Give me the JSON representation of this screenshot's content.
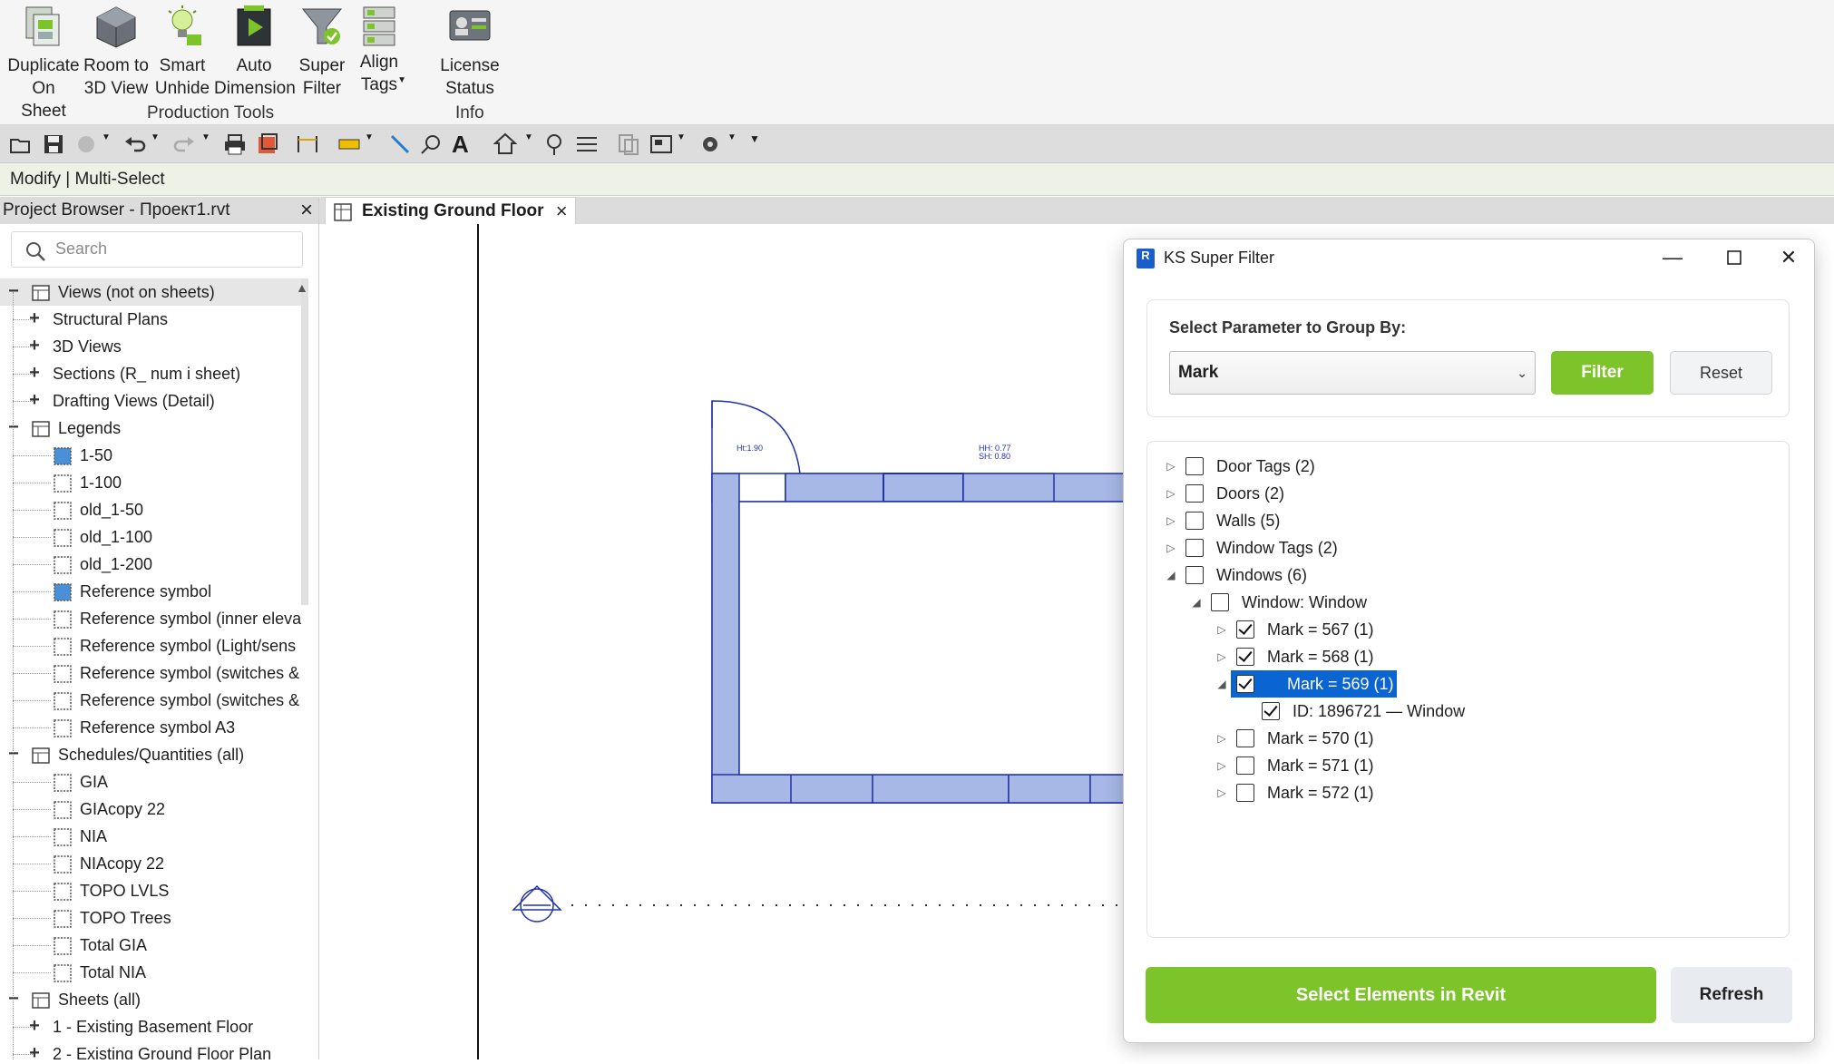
{
  "ribbon": {
    "tools": [
      {
        "label_1": "Duplicate",
        "label_2": "On Sheet",
        "icon": "duplicate-sheet-icon"
      },
      {
        "label_1": "Room to",
        "label_2": "3D View",
        "icon": "room-3d-icon"
      },
      {
        "label_1": "Smart",
        "label_2": "Unhide",
        "icon": "smart-unhide-icon"
      },
      {
        "label_1": "Auto",
        "label_2": "Dimension",
        "icon": "auto-dimension-icon"
      },
      {
        "label_1": "Super",
        "label_2": "Filter",
        "icon": "super-filter-icon"
      },
      {
        "label_1": "Align",
        "label_2": "Tags",
        "icon": "align-tags-icon"
      },
      {
        "label_1": "License Status",
        "label_2": "",
        "icon": "license-status-icon"
      }
    ],
    "panels": {
      "production": "Production Tools",
      "info": "Info"
    }
  },
  "modify_bar": {
    "text": "Modify | Multi-Select"
  },
  "project_browser": {
    "title": "Project Browser - Проект1.rvt",
    "search_placeholder": "Search",
    "items": [
      {
        "label": "Views (not on sheets)",
        "level": 0,
        "toggle": "−",
        "icon": "views-icon"
      },
      {
        "label": "Structural Plans",
        "level": 1,
        "toggle": "+"
      },
      {
        "label": "3D Views",
        "level": 1,
        "toggle": "+"
      },
      {
        "label": "Sections (R_ num i sheet)",
        "level": 1,
        "toggle": "+"
      },
      {
        "label": "Drafting Views (Detail)",
        "level": 1,
        "toggle": "+"
      },
      {
        "label": "Legends",
        "level": 0,
        "toggle": "−",
        "icon": "legend-icon"
      },
      {
        "label": "1-50",
        "level": 2,
        "icon": "legend-view-filled-icon"
      },
      {
        "label": "1-100",
        "level": 2,
        "icon": "legend-view-icon"
      },
      {
        "label": "old_1-50",
        "level": 2,
        "icon": "legend-view-icon"
      },
      {
        "label": "old_1-100",
        "level": 2,
        "icon": "legend-view-icon"
      },
      {
        "label": "old_1-200",
        "level": 2,
        "icon": "legend-view-icon"
      },
      {
        "label": "Reference symbol",
        "level": 2,
        "icon": "legend-view-filled-icon"
      },
      {
        "label": "Reference symbol (inner eleva",
        "level": 2,
        "icon": "legend-view-icon"
      },
      {
        "label": "Reference symbol (Light/sens",
        "level": 2,
        "icon": "legend-view-icon"
      },
      {
        "label": "Reference symbol (switches &",
        "level": 2,
        "icon": "legend-view-icon"
      },
      {
        "label": "Reference symbol (switches &",
        "level": 2,
        "icon": "legend-view-icon"
      },
      {
        "label": "Reference symbol A3",
        "level": 2,
        "icon": "legend-view-icon"
      },
      {
        "label": "Schedules/Quantities (all)",
        "level": 0,
        "toggle": "−",
        "icon": "schedule-icon"
      },
      {
        "label": "GIA",
        "level": 2,
        "icon": "schedule-view-icon"
      },
      {
        "label": "GIAcopy 22",
        "level": 2,
        "icon": "schedule-view-icon"
      },
      {
        "label": "NIA",
        "level": 2,
        "icon": "schedule-view-icon"
      },
      {
        "label": "NIAcopy 22",
        "level": 2,
        "icon": "schedule-view-icon"
      },
      {
        "label": "TOPO LVLS",
        "level": 2,
        "icon": "schedule-view-icon"
      },
      {
        "label": "TOPO Trees",
        "level": 2,
        "icon": "schedule-view-icon"
      },
      {
        "label": "Total GIA",
        "level": 2,
        "icon": "schedule-view-icon"
      },
      {
        "label": "Total NIA",
        "level": 2,
        "icon": "schedule-view-icon"
      },
      {
        "label": "Sheets (all)",
        "level": 0,
        "toggle": "−",
        "icon": "sheets-icon"
      },
      {
        "label": "1 - Existing Basement Floor",
        "level": 1,
        "toggle": "+"
      },
      {
        "label": "2 - Existing Ground Floor Plan",
        "level": 1,
        "toggle": "+"
      }
    ]
  },
  "view_tab": {
    "label": "Existing Ground Floor"
  },
  "plan": {
    "door_tag": "Ht:1.90",
    "window_tag_1": "HH: 0.77",
    "window_tag_2": "SH: 0.80"
  },
  "dialog": {
    "title": "KS Super Filter",
    "app_badge": "R",
    "group_by_label": "Select Parameter to Group By:",
    "group_by_value": "Mark",
    "filter_label": "Filter",
    "reset_label": "Reset",
    "tree": [
      {
        "label": "Door Tags (2)",
        "indent": 0,
        "arrow": "▷",
        "checked": false
      },
      {
        "label": "Doors (2)",
        "indent": 0,
        "arrow": "▷",
        "checked": false
      },
      {
        "label": "Walls (5)",
        "indent": 0,
        "arrow": "▷",
        "checked": false
      },
      {
        "label": "Window Tags (2)",
        "indent": 0,
        "arrow": "▷",
        "checked": false
      },
      {
        "label": "Windows (6)",
        "indent": 0,
        "arrow": "◢",
        "checked": false
      },
      {
        "label": "Window: Window",
        "indent": 1,
        "arrow": "◢",
        "checked": false
      },
      {
        "label": "Mark = 567 (1)",
        "indent": 2,
        "arrow": "▷",
        "checked": true
      },
      {
        "label": "Mark = 568 (1)",
        "indent": 2,
        "arrow": "▷",
        "checked": true
      },
      {
        "label": "Mark = 569 (1)",
        "indent": 2,
        "arrow": "◢",
        "checked": true,
        "highlighted": true
      },
      {
        "label": "ID: 1896721 — Window",
        "indent": 3,
        "arrow": "",
        "checked": true
      },
      {
        "label": "Mark = 570 (1)",
        "indent": 2,
        "arrow": "▷",
        "checked": false
      },
      {
        "label": "Mark = 571 (1)",
        "indent": 2,
        "arrow": "▷",
        "checked": false
      },
      {
        "label": "Mark = 572 (1)",
        "indent": 2,
        "arrow": "▷",
        "checked": false
      }
    ],
    "select_btn": "Select Elements in Revit",
    "refresh_btn": "Refresh"
  },
  "colors": {
    "accent_green": "#7dc42a",
    "selection_blue": "#0a64d2",
    "wall_fill": "#a8b8e6",
    "wall_stroke": "#2233aa"
  }
}
